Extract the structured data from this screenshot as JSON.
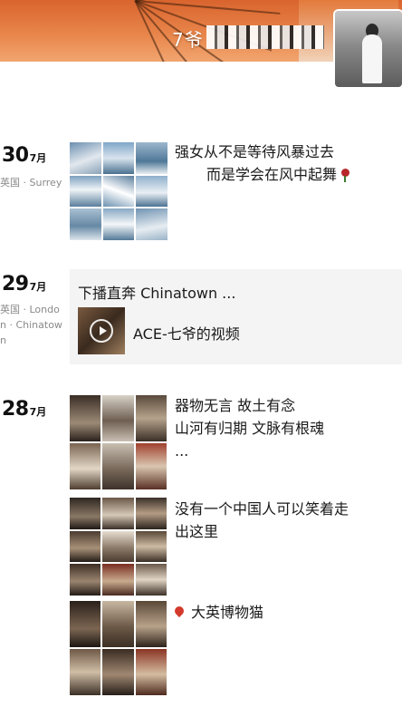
{
  "header": {
    "nickname": "7爷",
    "nickname_blur_icon": "pixelated-censor"
  },
  "posts": [
    {
      "day": "30",
      "month": "7月",
      "location": "英国 · Surrey",
      "text_line1": "强女从不是等待风暴过去",
      "text_line2": "而是学会在风中起舞",
      "emoji_icon": "rose-icon",
      "photo_count": 9
    },
    {
      "day": "29",
      "month": "7月",
      "location": "英国 · London · Chinatown",
      "share_title": "下播直奔 Chinatown ...",
      "video_title": "ACE-七爷的视频",
      "video_icon": "play-icon"
    },
    {
      "day": "28",
      "month": "7月",
      "groups": [
        {
          "lines": [
            "器物无言 故土有念",
            "山河有归期 文脉有根魂",
            "..."
          ]
        },
        {
          "lines": [
            "没有一个中国人可以笑着走",
            "出这里"
          ]
        },
        {
          "lines": [
            "大英博物猫"
          ],
          "icon": "location-pin-icon"
        }
      ]
    }
  ],
  "colors": {
    "cover_orange": "#d9642e",
    "pin_red": "#d33a2c",
    "location_gray": "#8a8a8a",
    "share_bg": "#f4f4f4"
  }
}
